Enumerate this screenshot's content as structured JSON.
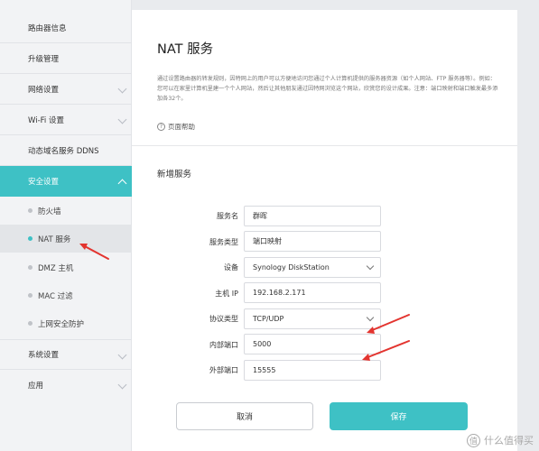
{
  "sidebar": {
    "items": [
      {
        "label": "路由器信息"
      },
      {
        "label": "升级管理"
      },
      {
        "label": "网络设置"
      },
      {
        "label": "Wi-Fi 设置"
      },
      {
        "label": "动态域名服务 DDNS"
      },
      {
        "label": "安全设置"
      },
      {
        "label": "系统设置"
      },
      {
        "label": "应用"
      }
    ],
    "sub_items": [
      {
        "label": "防火墙"
      },
      {
        "label": "NAT 服务"
      },
      {
        "label": "DMZ 主机"
      },
      {
        "label": "MAC 过滤"
      },
      {
        "label": "上网安全防护"
      }
    ]
  },
  "main": {
    "title": "NAT 服务",
    "description": "通过设置路由器的转发规则，因特网上的用户可以方便地访问您通过个人计算机提供的服务器资源（如个人网站、FTP 服务器等）。例如：您可以在家里计算机里建一个个人网站，然后让其他朋友通过因特网浏览这个网站，欣赏您的设计成果。注意：端口映射和端口触发最多添加各32个。",
    "help_label": "页面帮助",
    "help_icon": "?",
    "section_title": "新增服务"
  },
  "form": {
    "service_name": {
      "label": "服务名",
      "value": "群晖"
    },
    "service_type": {
      "label": "服务类型",
      "value": "端口映射"
    },
    "device": {
      "label": "设备",
      "value": "Synology DiskStation"
    },
    "host_ip": {
      "label": "主机 IP",
      "value": "192.168.2.171"
    },
    "protocol": {
      "label": "协议类型",
      "value": "TCP/UDP"
    },
    "internal_port": {
      "label": "内部端口",
      "value": "5000"
    },
    "external_port": {
      "label": "外部端口",
      "value": "15555"
    }
  },
  "buttons": {
    "cancel": "取消",
    "save": "保存"
  },
  "watermark": {
    "icon": "值",
    "text": "什么值得买"
  },
  "colors": {
    "accent": "#3ec1c5",
    "annotation": "#e3342f"
  }
}
